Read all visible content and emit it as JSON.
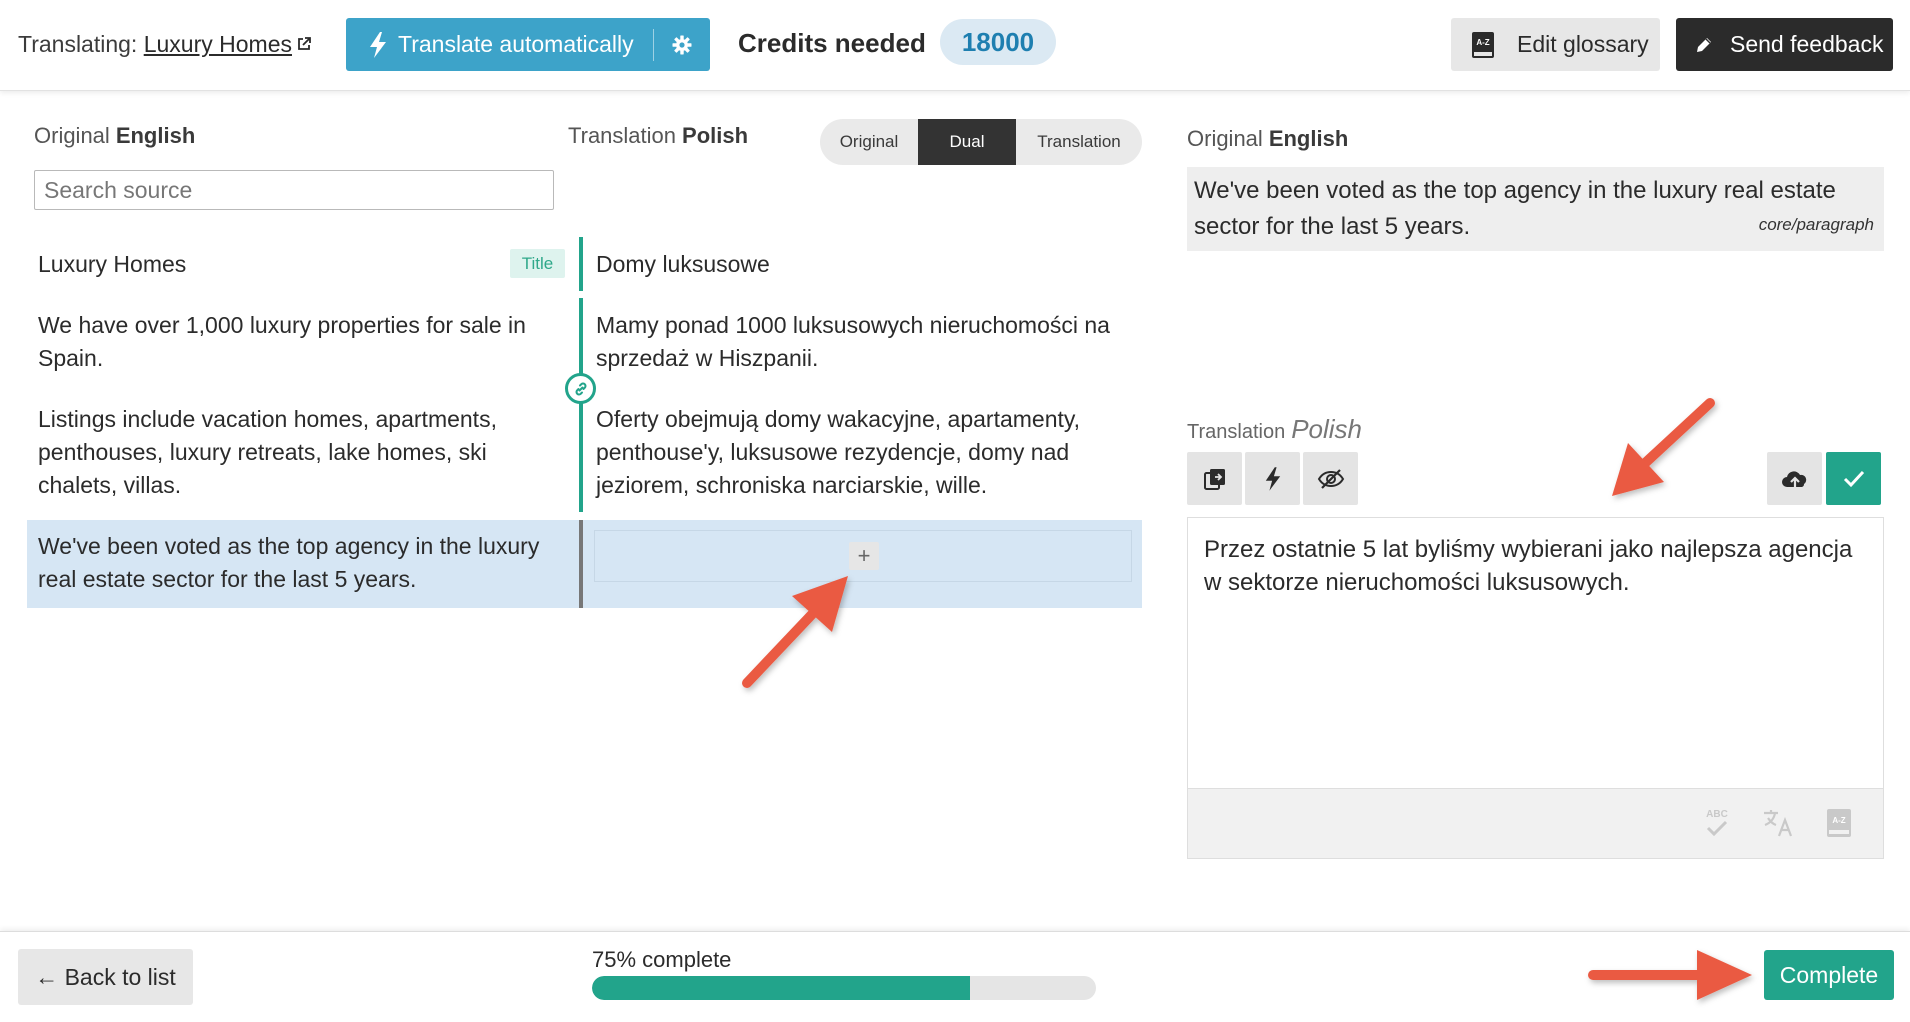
{
  "header": {
    "translating_label": "Translating:",
    "page_link": "Luxury Homes",
    "translate_button": "Translate automatically",
    "credits_label": "Credits needed",
    "credits_value": "18000",
    "glossary_button": "Edit glossary",
    "feedback_button": "Send feedback"
  },
  "editor": {
    "original_label": "Original",
    "original_language": "English",
    "translation_label": "Translation",
    "translation_language": "Polish",
    "search_placeholder": "Search source",
    "view_modes": [
      "Original",
      "Dual",
      "Translation"
    ],
    "selected_view": "Dual",
    "title_badge": "Title",
    "segments": [
      {
        "source": "Luxury Homes",
        "target": "Domy luksusowe"
      },
      {
        "source": "We have over 1,000 luxury properties for sale in Spain.",
        "target": "Mamy ponad 1000 luksusowych nieruchomości na sprzedaż w Hiszpanii."
      },
      {
        "source": "Listings include vacation homes, apartments, penthouses, luxury retreats, lake homes, ski chalets, villas.",
        "target": "Oferty obejmują domy wakacyjne, apartamenty, penthouse'y, luksusowe rezydencje, domy nad jeziorem, schroniska narciarskie, wille."
      },
      {
        "source": "We've been voted as the top agency in the luxury real estate sector for the last 5 years.",
        "target": ""
      }
    ],
    "add_symbol": "+"
  },
  "panel": {
    "original_label": "Original",
    "original_language": "English",
    "original_text": "We've been voted as the top agency in the luxury real estate sector for the last 5 years.",
    "block_type": "core/paragraph",
    "translation_label": "Translation",
    "translation_language": "Polish",
    "translation_text": "Przez ostatnie 5 lat byliśmy wybierani jako najlepsza agencja w sektorze nieruchomości luksusowych.",
    "toolbar_icons": [
      "copy-source-icon",
      "lightning-icon",
      "hide-icon",
      "cloud-upload-icon",
      "check-icon"
    ],
    "footer_icons": [
      "spellcheck-icon",
      "translate-icon",
      "glossary-icon"
    ],
    "spellcheck_text": "ABC",
    "glossary_text": "A-Z"
  },
  "footer": {
    "back_button": "← Back to list",
    "progress_label": "75% complete",
    "progress_value": 0.75,
    "complete_button": "Complete"
  },
  "colors": {
    "accent_blue": "#3da3c9",
    "accent_green": "#22a48b",
    "arrow_red": "#ea5a43",
    "active_row": "#d6e6f4"
  }
}
